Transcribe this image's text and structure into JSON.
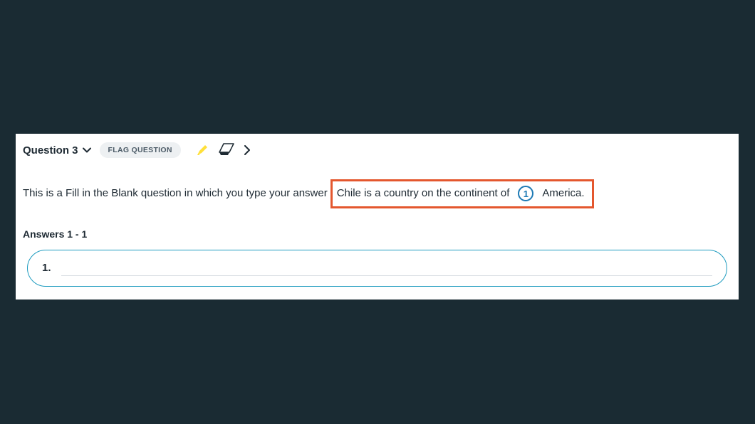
{
  "header": {
    "question_label": "Question 3",
    "flag_label": "FLAG QUESTION"
  },
  "prompt": {
    "instruction": "This is a Fill in the Blank question in which you type your answer",
    "sentence_before": "Chile is a country on the continent of",
    "blank_number": "1",
    "sentence_after": "America."
  },
  "answers": {
    "section_label": "Answers 1 - 1",
    "item_number": "1.",
    "value": ""
  }
}
